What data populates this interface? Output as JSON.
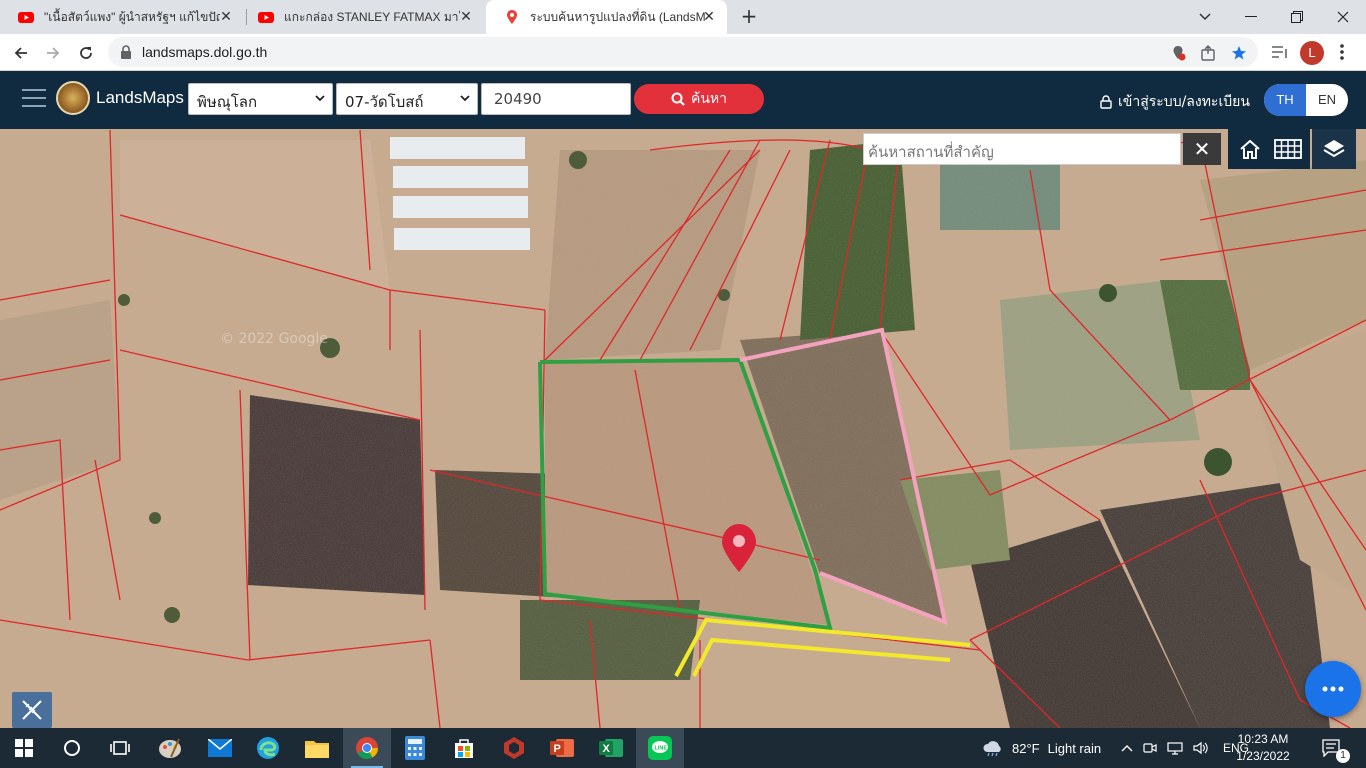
{
  "browser": {
    "tabs": [
      {
        "title": "\"เนื้อสัตว์แพง\" ผู้นำสหรัฐฯ แก้ไขปัญหา",
        "icon": "youtube-icon"
      },
      {
        "title": "แกะกล่อง STANLEY FATMAX มาให้ชม",
        "icon": "youtube-icon"
      },
      {
        "title": "ระบบค้นหารูปแปลงที่ดิน (LandsMaps)",
        "icon": "map-pin-icon"
      }
    ],
    "url": "landsmaps.dol.go.th",
    "profile_initial": "L"
  },
  "site": {
    "brand": "LandsMaps",
    "province": "พิษณุโลก",
    "district": "07-วัดโบสถ์",
    "parcel_number": "20490",
    "search_label": "ค้นหา",
    "login_label": "เข้าสู่ระบบ/ลงทะเบียน",
    "lang_th": "TH",
    "lang_en": "EN"
  },
  "map": {
    "place_search_placeholder": "ค้นหาสถานที่สำคัญ",
    "clear_symbol": "✕",
    "watermark": "© 2022 Google",
    "outline_colors": {
      "green": "#2ea043",
      "pink": "#f4a3bf",
      "yellow": "#f3e92a",
      "parcel": "#e0262a",
      "pin": "#d9233a"
    }
  },
  "taskbar": {
    "weather_temp": "82°F",
    "weather_text": "Light rain",
    "lang": "ENG",
    "time": "10:23 AM",
    "date": "1/23/2022",
    "notification_count": "1"
  }
}
